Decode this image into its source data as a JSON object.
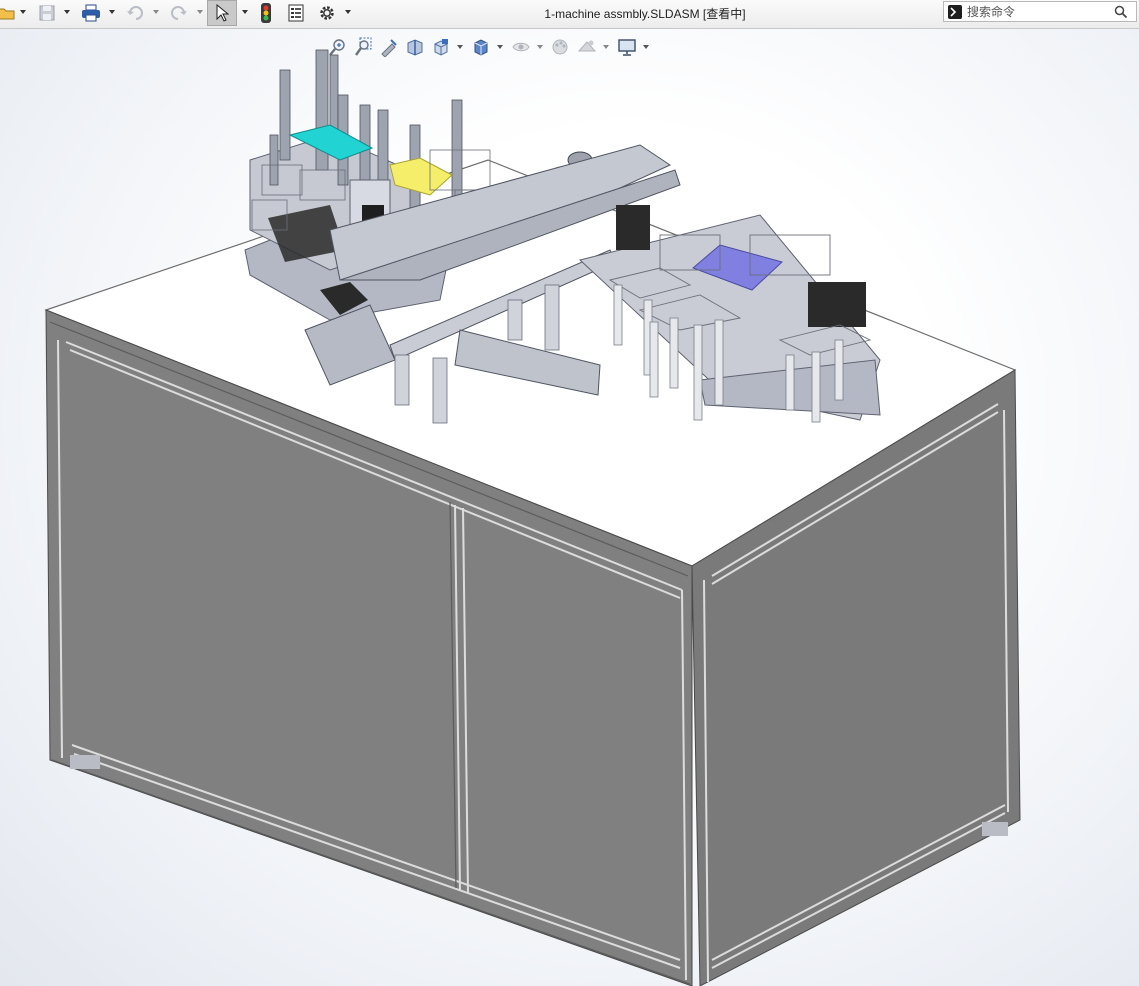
{
  "window": {
    "title": "1-machine assmbly.SLDASM [查看中]"
  },
  "toolbar": {
    "items": [
      "open-icon",
      "save-icon",
      "print-icon",
      "undo-icon",
      "redo-icon",
      "select-icon",
      "rebuild-icon",
      "file-properties-icon",
      "options-icon"
    ]
  },
  "search": {
    "placeholder": "搜索命令"
  },
  "headsup_toolbar": {
    "items": [
      "zoom-to-fit-icon",
      "zoom-to-area-icon",
      "previous-view-icon",
      "section-view-icon",
      "view-orientation-icon",
      "display-style-icon",
      "hide-show-items-icon",
      "edit-appearance-icon",
      "apply-scene-icon",
      "view-settings-icon"
    ]
  },
  "colors": {
    "cabinet_front": "#808080",
    "cabinet_side": "#7a7a7a",
    "tabletop": "#ffffff",
    "frame": "#9a9a9a",
    "accent_cyan": "#22d3d3",
    "accent_yellow": "#f5ee6a",
    "accent_blue": "#8080e0",
    "motor_black": "#2a2a2a",
    "metal": "#b4b8c4"
  }
}
